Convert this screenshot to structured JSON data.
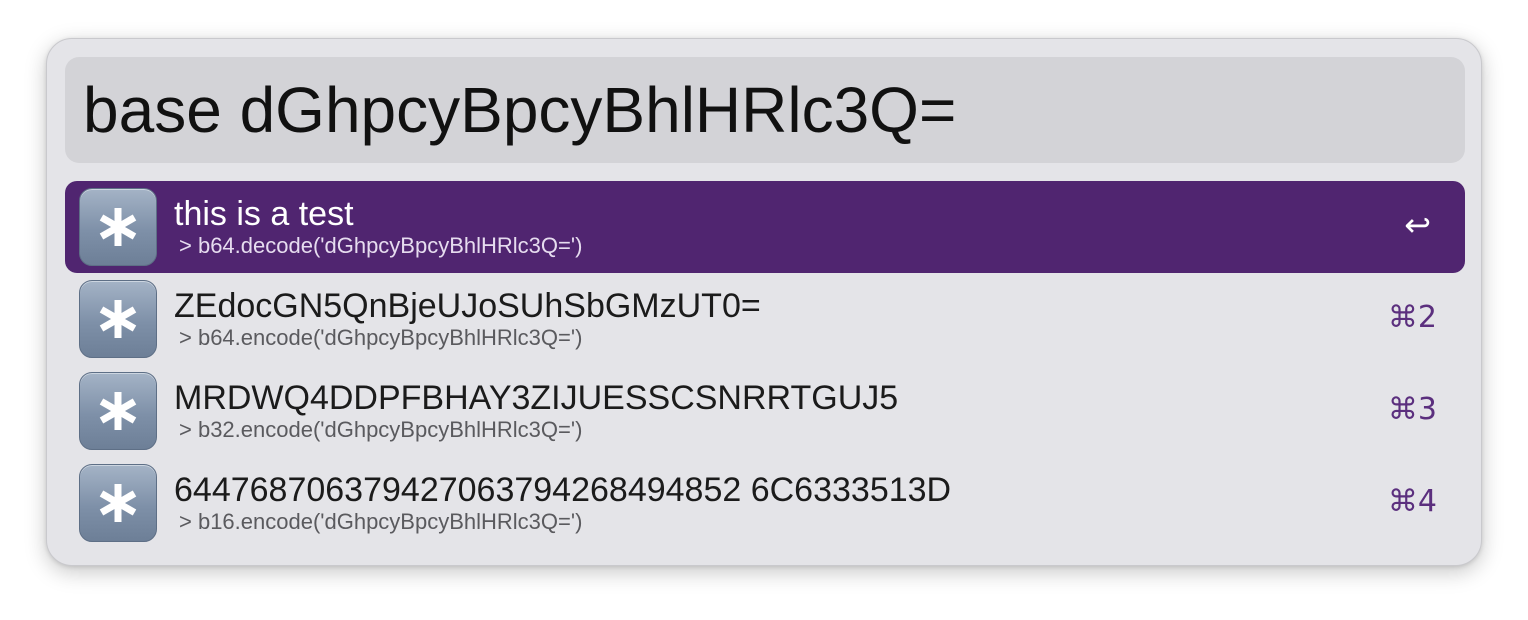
{
  "search": {
    "query": "base dGhpcyBpcyBhlHRlc3Q="
  },
  "results": [
    {
      "title": "this is a test",
      "subtitle": "> b64.decode('dGhpcyBpcyBhlHRlc3Q=')",
      "shortcut": "↩",
      "icon": "asterisk-icon",
      "selected": true
    },
    {
      "title": "ZEdocGN5QnBjeUJoSUhSbGMzUT0=",
      "subtitle": "> b64.encode('dGhpcyBpcyBhlHRlc3Q=')",
      "shortcut": "⌘2",
      "icon": "asterisk-icon",
      "selected": false
    },
    {
      "title": "MRDWQ4DDPFBHAY3ZIJUESSCSNRRTGUJ5",
      "subtitle": "> b32.encode('dGhpcyBpcyBhlHRlc3Q=')",
      "shortcut": "⌘3",
      "icon": "asterisk-icon",
      "selected": false
    },
    {
      "title": "644768706379427063794268494852 6C6333513D",
      "subtitle": "> b16.encode('dGhpcyBpcyBhlHRlc3Q=')",
      "shortcut": "⌘4",
      "icon": "asterisk-icon",
      "selected": false
    }
  ],
  "colors": {
    "selection": "#502570",
    "shortcut": "#5b2f7e",
    "panel": "#e4e4e8",
    "query_background": "#d3d3d7"
  }
}
